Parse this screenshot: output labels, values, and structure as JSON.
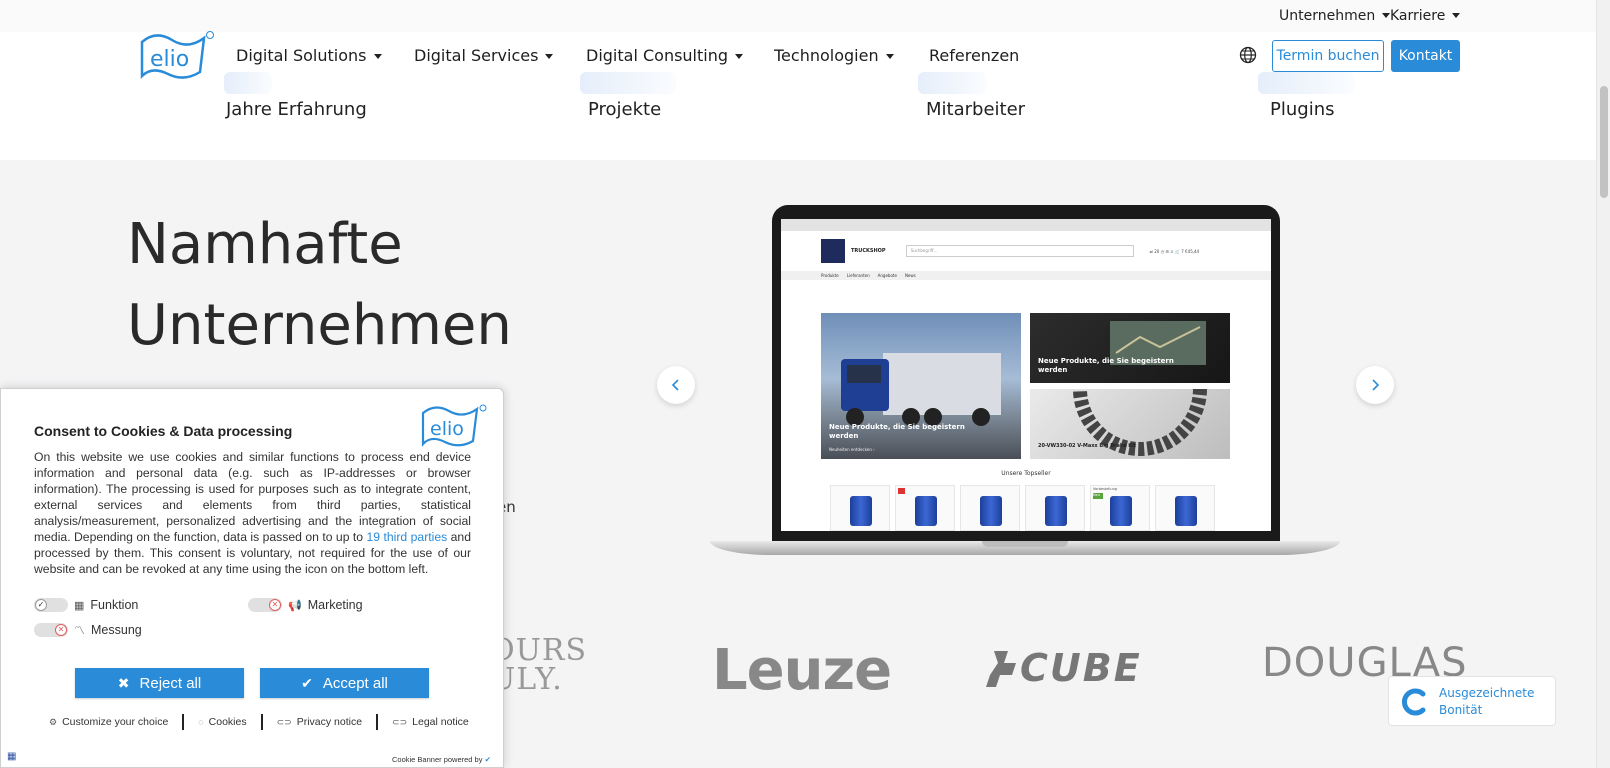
{
  "utility_bar": {
    "unternehmen": "Unternehmen",
    "karriere": "Karriere"
  },
  "header": {
    "logo_text": "elio",
    "nav": [
      {
        "label": "Digital Solutions"
      },
      {
        "label": "Digital Services"
      },
      {
        "label": "Digital Consulting"
      },
      {
        "label": "Technologien"
      },
      {
        "label": "Referenzen"
      }
    ],
    "globe_icon": "globe-icon",
    "termin_label": "Termin buchen",
    "kontakt_label": "Kontakt"
  },
  "stats": [
    {
      "label": "Jahre Erfahrung"
    },
    {
      "label": "Projekte"
    },
    {
      "label": "Mitarbeiter"
    },
    {
      "label": "Plugins"
    }
  ],
  "main": {
    "headline_line1": "Namhafte",
    "headline_line2": "Unternehmen",
    "partial_text": "en"
  },
  "laptop_screen": {
    "shop_name": "TRUCKSHOP",
    "search_placeholder": "Suchbegriff...",
    "header_icons": "⇄ 20   ◷   ☰   ♙   🛒 7 €45,44",
    "nav": [
      "Produkte",
      "Lieferanten",
      "Angebote",
      "News"
    ],
    "tile_main_text": "Neue Produkte, die Sie begeistern werden",
    "tile_main_sub": "Neuheiten entdecken  ›",
    "tile_top_text": "Neue Produkte, die Sie begeistern werden",
    "tile_bottom_text": "20-VW330-02 V-Maxx Big Brake Kit",
    "topseller": "Unsere Topseller",
    "badge_new": "Neu",
    "badge_vorschau": "Vorbestellung"
  },
  "brands": {
    "yours": "OURS\nULY.",
    "leuze": "Leuze",
    "cube": "CUBE",
    "douglas": "DOUGLAS"
  },
  "badge": {
    "line1": "Ausgezeichnete",
    "line2": "Bonität",
    "icon": "creditreform-c-icon"
  },
  "cookie": {
    "title": "Consent to Cookies & Data processing",
    "body_part1": "On this website we use cookies and similar functions to process end device information and personal data (e.g. such as IP-addresses or browser information). The processing is used for purposes such as to integrate content, external services and elements from third parties, statistical analysis/measurement, personalized advertising and the integration of social media. Depending on the function, data is passed on to up to ",
    "third_parties_link": "19 third parties",
    "body_part2": " and processed by them. This consent is voluntary, not required for the use of our website and can be revoked at any time using the icon on the bottom left.",
    "categories": [
      {
        "label": "Funktion",
        "icon": "grid-icon"
      },
      {
        "label": "Marketing",
        "icon": "megaphone-icon"
      },
      {
        "label": "Messung",
        "icon": "chart-line-icon"
      }
    ],
    "reject_label": "Reject all",
    "accept_label": "Accept all",
    "links": [
      {
        "label": "Customize your choice",
        "icon": "gear-icon"
      },
      {
        "label": "Cookies",
        "icon": "cookie-icon"
      },
      {
        "label": "Privacy notice",
        "icon": "link-icon"
      },
      {
        "label": "Legal notice",
        "icon": "link-icon"
      }
    ],
    "powered_by": "Cookie Banner powered by"
  },
  "colors": {
    "accent": "#2a8bd8",
    "background": "#f4f4f5",
    "text": "#222222"
  }
}
